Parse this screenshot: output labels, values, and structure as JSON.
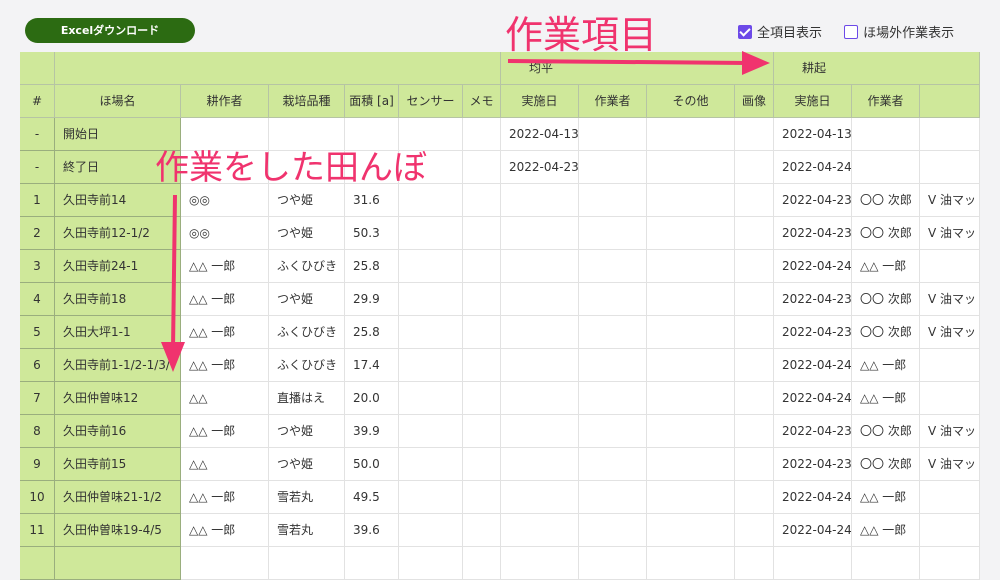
{
  "toolbar": {
    "excel_label": "Excelダウンロード"
  },
  "checkboxes": [
    {
      "label": "全項目表示",
      "checked": true
    },
    {
      "label": "ほ場外作業表示",
      "checked": false
    }
  ],
  "header_groups": {
    "kinpei": "均平",
    "kouki": "耕起"
  },
  "columns": [
    "#",
    "ほ場名",
    "耕作者",
    "栽培品種",
    "面積 [a]",
    "センサー",
    "メモ",
    "実施日",
    "作業者",
    "その他",
    "画像",
    "実施日",
    "作業者",
    ""
  ],
  "rows": [
    [
      "-",
      "開始日",
      "",
      "",
      "",
      "",
      "",
      "2022-04-13",
      "",
      "",
      "",
      "2022-04-13",
      "",
      ""
    ],
    [
      "-",
      "終了日",
      "",
      "",
      "",
      "",
      "",
      "2022-04-23",
      "",
      "",
      "",
      "2022-04-24",
      "",
      ""
    ],
    [
      "1",
      "久田寺前14",
      "◎◎",
      "つや姫",
      "31.6",
      "",
      "",
      "",
      "",
      "",
      "",
      "2022-04-23",
      "〇〇 次郎",
      "V 油マッ・"
    ],
    [
      "2",
      "久田寺前12-1/2",
      "◎◎",
      "つや姫",
      "50.3",
      "",
      "",
      "",
      "",
      "",
      "",
      "2022-04-23",
      "〇〇 次郎",
      "V 油マッ・"
    ],
    [
      "3",
      "久田寺前24-1",
      "△△ 一郎",
      "ふくひびき",
      "25.8",
      "",
      "",
      "",
      "",
      "",
      "",
      "2022-04-24",
      "△△ 一郎",
      ""
    ],
    [
      "4",
      "久田寺前18",
      "△△ 一郎",
      "つや姫",
      "29.9",
      "",
      "",
      "",
      "",
      "",
      "",
      "2022-04-23",
      "〇〇 次郎",
      "V 油マッ・"
    ],
    [
      "5",
      "久田大坪1-1",
      "△△ 一郎",
      "ふくひびき",
      "25.8",
      "",
      "",
      "",
      "",
      "",
      "",
      "2022-04-23",
      "〇〇 次郎",
      "V 油マッ・"
    ],
    [
      "6",
      "久田寺前1-1/2-1/3/",
      "△△ 一郎",
      "ふくひびき",
      "17.4",
      "",
      "",
      "",
      "",
      "",
      "",
      "2022-04-24",
      "△△ 一郎",
      ""
    ],
    [
      "7",
      "久田仲曽味12",
      "△△",
      "直播はえ",
      "20.0",
      "",
      "",
      "",
      "",
      "",
      "",
      "2022-04-24",
      "△△ 一郎",
      ""
    ],
    [
      "8",
      "久田寺前16",
      "△△ 一郎",
      "つや姫",
      "39.9",
      "",
      "",
      "",
      "",
      "",
      "",
      "2022-04-23",
      "〇〇 次郎",
      "V 油マッ・"
    ],
    [
      "9",
      "久田寺前15",
      "△△",
      "つや姫",
      "50.0",
      "",
      "",
      "",
      "",
      "",
      "",
      "2022-04-23",
      "〇〇 次郎",
      "V 油マッ・"
    ],
    [
      "10",
      "久田仲曽味21-1/2",
      "△△ 一郎",
      "雪若丸",
      "49.5",
      "",
      "",
      "",
      "",
      "",
      "",
      "2022-04-24",
      "△△ 一郎",
      ""
    ],
    [
      "11",
      "久田仲曽味19-4/5",
      "△△ 一郎",
      "雪若丸",
      "39.6",
      "",
      "",
      "",
      "",
      "",
      "",
      "2022-04-24",
      "△△ 一郎",
      ""
    ],
    [
      "",
      "",
      "",
      "",
      "",
      "",
      "",
      "",
      "",
      "",
      "",
      "",
      "",
      ""
    ]
  ],
  "annotations": {
    "work_items": "作業項目",
    "worked_fields": "作業をした田んぼ"
  },
  "colors": {
    "accent": "#f0336e",
    "header_green": "#cfe89a",
    "button_green": "#2c6b12",
    "checkbox": "#6c49e8"
  }
}
